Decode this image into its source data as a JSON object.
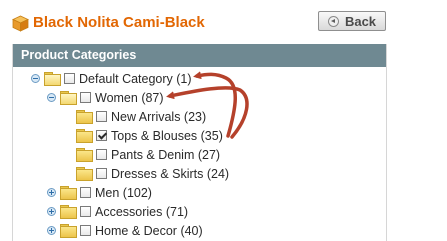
{
  "header": {
    "title": "Black Nolita Cami-Black",
    "back_label": "Back",
    "title_color": "#e26703"
  },
  "panel": {
    "heading": "Product Categories",
    "header_color": "#6f8992"
  },
  "tree": [
    {
      "label": "Default Category (1)",
      "expanded": true,
      "checked": false,
      "annotated": true
    },
    {
      "label": "Women (87)",
      "expanded": true,
      "checked": false,
      "annotated": true
    },
    {
      "label": "New Arrivals (23)",
      "checked": false
    },
    {
      "label": "Tops & Blouses (35)",
      "checked": true
    },
    {
      "label": "Pants & Denim (27)",
      "checked": false
    },
    {
      "label": "Dresses & Skirts (24)",
      "checked": false
    },
    {
      "label": "Men (102)",
      "expanded": false,
      "checked": false
    },
    {
      "label": "Accessories (71)",
      "expanded": false,
      "checked": false
    },
    {
      "label": "Home & Decor (40)",
      "expanded": false,
      "checked": false
    }
  ],
  "annotation": {
    "arrow_color": "#b5412b"
  }
}
